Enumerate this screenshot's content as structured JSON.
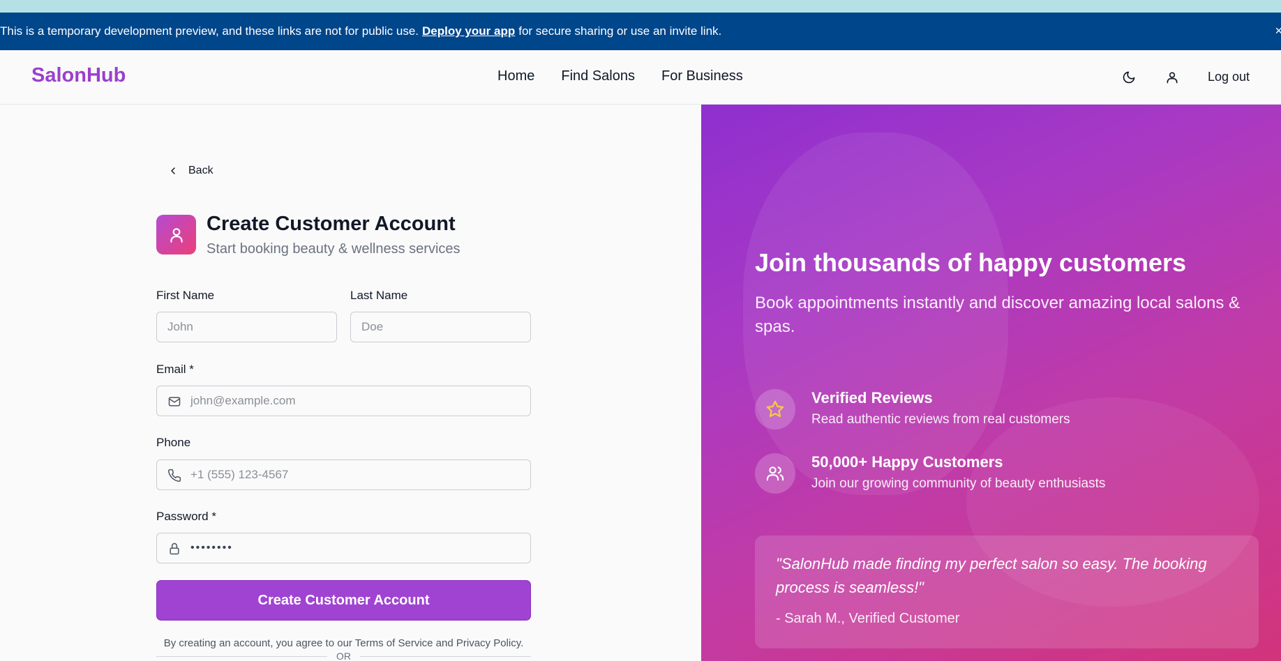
{
  "banner": {
    "text_before": "This is a temporary development preview, and these links are not for public use.",
    "link_text": "Deploy your app",
    "text_after": "for secure sharing or use an invite link.",
    "close": "×"
  },
  "nav": {
    "brand": "SalonHub",
    "links": [
      "Home",
      "Find Salons",
      "For Business"
    ],
    "logout": "Log out",
    "icons": [
      "moon-icon",
      "user-icon"
    ]
  },
  "form": {
    "back": "Back",
    "title": "Create Customer Account",
    "subtitle": "Start booking beauty & wellness services",
    "first_name": {
      "label": "First Name",
      "placeholder": "John",
      "value": ""
    },
    "last_name": {
      "label": "Last Name",
      "placeholder": "Doe",
      "value": ""
    },
    "email": {
      "label": "Email *",
      "placeholder": "john@example.com",
      "value": ""
    },
    "phone": {
      "label": "Phone",
      "placeholder": "+1 (555) 123-4567",
      "value": ""
    },
    "password": {
      "label": "Password *",
      "value": "••••••••"
    },
    "submit": "Create Customer Account",
    "terms": "By creating an account, you agree to our Terms of Service and Privacy Policy.",
    "divider": "OR"
  },
  "hero": {
    "title": "Join thousands of happy customers",
    "subtitle": "Book appointments instantly and discover amazing local salons & spas.",
    "features": [
      {
        "icon": "star-icon",
        "title": "Verified Reviews",
        "desc": "Read authentic reviews from real customers"
      },
      {
        "icon": "users-icon",
        "title": "50,000+ Happy Customers",
        "desc": "Join our growing community of beauty enthusiasts"
      }
    ],
    "quote": "\"SalonHub made finding my perfect salon so easy. The booking process is seamless!\"",
    "quote_author": "- Sarah M., Verified Customer"
  },
  "colors": {
    "brand": "#9b3fce",
    "banner": "#00468b",
    "button": "#a043d2",
    "hero_start": "#8f2fcf",
    "hero_end": "#d2347b",
    "star": "#f5c84a"
  }
}
